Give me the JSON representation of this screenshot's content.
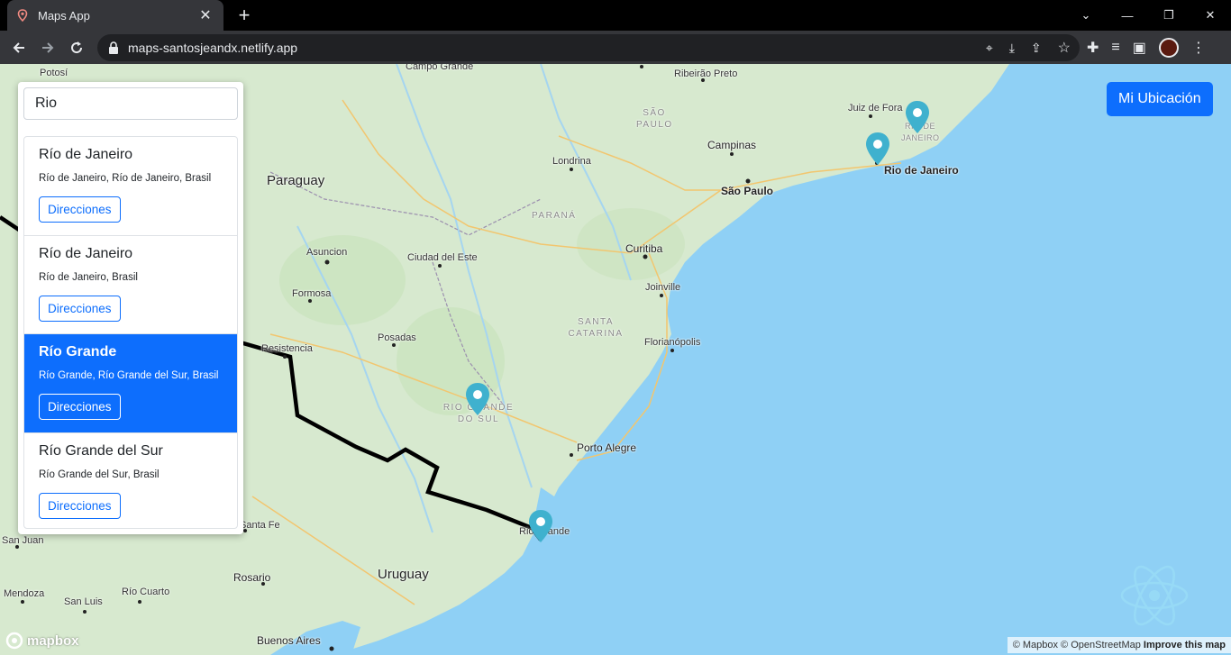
{
  "browser": {
    "tab_title": "Maps App",
    "url": "maps-santosjeandx.netlify.app"
  },
  "search": {
    "value": "Rio"
  },
  "results": [
    {
      "title": "Río de Janeiro",
      "subtitle": "Río de Janeiro, Río de Janeiro, Brasil",
      "button": "Direcciones",
      "active": false
    },
    {
      "title": "Río de Janeiro",
      "subtitle": "Río de Janeiro, Brasil",
      "button": "Direcciones",
      "active": false
    },
    {
      "title": "Río Grande",
      "subtitle": "Río Grande, Río Grande del Sur, Brasil",
      "button": "Direcciones",
      "active": true
    },
    {
      "title": "Río Grande del Sur",
      "subtitle": "Río Grande del Sur, Brasil",
      "button": "Direcciones",
      "active": false
    }
  ],
  "my_location_button": "Mi Ubicación",
  "map_labels": {
    "potosi": "Potosí",
    "campo_grande": "Campo Grande",
    "ribeirao": "Ribeirão Preto",
    "sao_paulo_state": "SÃO PAULO",
    "juiz_de_fora": "Juiz de Fora",
    "rio_state": "RIO DE JANEIRO",
    "campinas": "Campinas",
    "rio_city": "Rio de Janeiro",
    "londrina": "Londrina",
    "paraguay": "Paraguay",
    "sao_paulo": "São Paulo",
    "parana": "PARANÁ",
    "curitiba": "Curitiba",
    "asuncion": "Asuncion",
    "ciudad_del_este": "Ciudad del Este",
    "joinville": "Joinville",
    "formosa": "Formosa",
    "santa_catarina": "SANTA CATARINA",
    "posadas": "Posadas",
    "florianopolis": "Florianópolis",
    "resistencia": "Resistencia",
    "rs_state": "RIO GRANDE DO SUL",
    "porto_alegre": "Porto Alegre",
    "rio_grande": "Rio Grande",
    "santa_fe": "Santa Fe",
    "san_juan": "San Juan",
    "rosario": "Rosario",
    "uruguay": "Uruguay",
    "mendoza": "Mendoza",
    "rio_cuarto": "Río Cuarto",
    "san_luis": "San Luis",
    "buenos_aires": "Buenos Aires"
  },
  "mapbox_logo": "mapbox",
  "attribution": {
    "text": "© Mapbox © OpenStreetMap",
    "improve": "Improve this map"
  },
  "colors": {
    "primary": "#0d6efd",
    "ocean": "#7fc8f0",
    "land": "#d8ead0",
    "marker": "#3fb1ce"
  }
}
